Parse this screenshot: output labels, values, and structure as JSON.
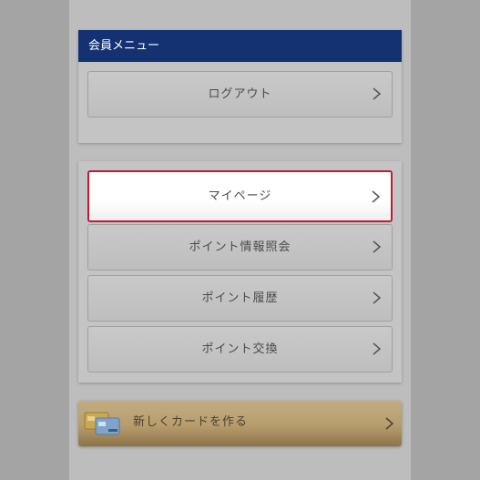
{
  "member_menu": {
    "title": "会員メニュー",
    "logout_label": "ログアウト"
  },
  "main_menu": {
    "items": [
      {
        "label": "マイページ",
        "selected": true
      },
      {
        "label": "ポイント情報照会",
        "selected": false
      },
      {
        "label": "ポイント履歴",
        "selected": false
      },
      {
        "label": "ポイント交換",
        "selected": false
      }
    ]
  },
  "banner": {
    "label": "新しくカードを作る"
  },
  "colors": {
    "header_bg": "#143172",
    "selected_border": "#c31932",
    "banner_gold": "#b79d6d"
  },
  "icons": {
    "chevron": "chevron-right-icon",
    "card": "card-icon"
  }
}
